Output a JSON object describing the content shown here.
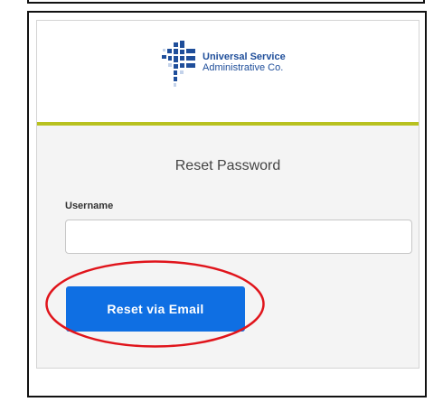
{
  "logo": {
    "line1": "Universal Service",
    "line2": "Administrative Co.",
    "brand_color": "#1f4e9a"
  },
  "form": {
    "title": "Reset Password",
    "username_label": "Username",
    "username_value": "",
    "submit_label": "Reset via Email"
  },
  "colors": {
    "accent_line": "#b8c11f",
    "button": "#0f6fe3",
    "highlight_ring": "#e0141b"
  }
}
